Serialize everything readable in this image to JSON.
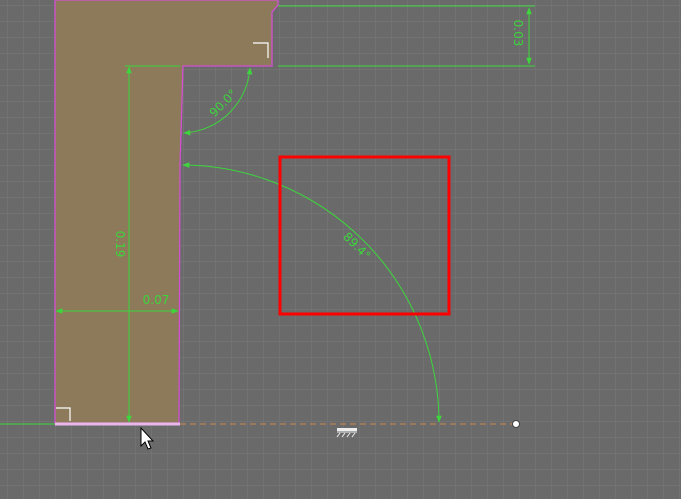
{
  "canvas": {
    "background": "#6a6a6a",
    "grid_color": "#7a7a7a",
    "sketch_fill": "#8c7a5a",
    "sketch_outline": "#d24fd2",
    "dimension_color": "#3dd63d",
    "selection_box_color": "#ff0000"
  },
  "dimensions": {
    "top_offset": "0.03",
    "angle_top": "90.0°",
    "angle_arc": "89.4°",
    "height": "0.19",
    "width": "0.07"
  },
  "icons": {
    "ground_constraint": "ground-constraint-icon",
    "cursor": "mouse-pointer-icon",
    "endpoint": "endpoint-dot-icon",
    "corner_top": "perpendicular-corner-icon",
    "corner_bottom": "perpendicular-corner-icon"
  }
}
